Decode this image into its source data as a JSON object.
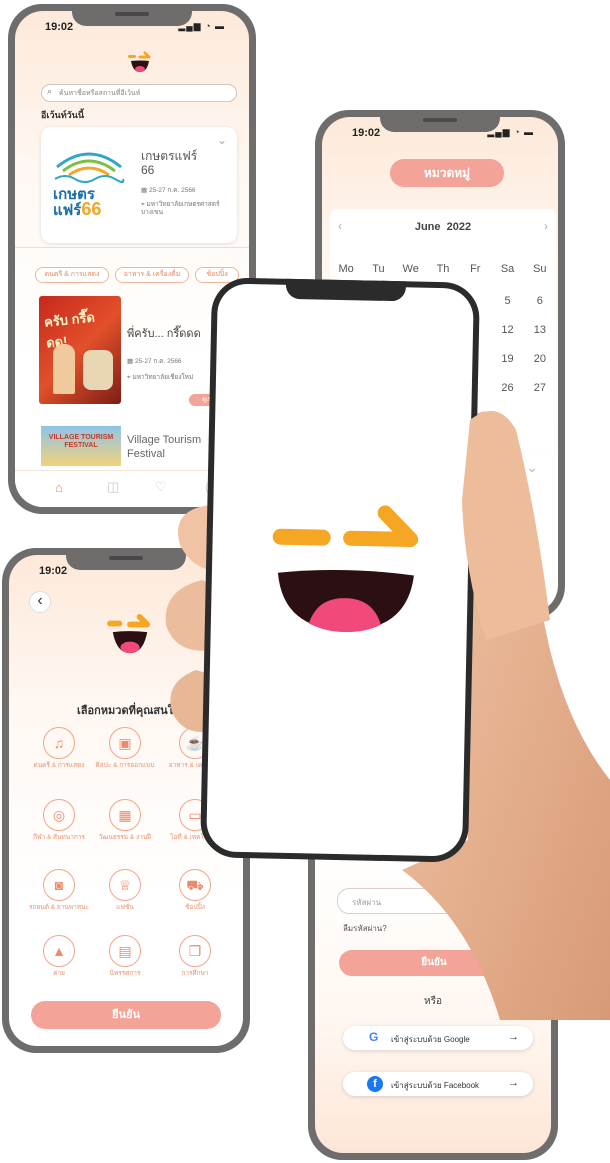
{
  "colors": {
    "accent": "#f3a397",
    "orange": "#f5a623",
    "mouth": "#2b0f12",
    "tongue": "#f0497a",
    "frame": "#6f6d6c"
  },
  "phone_home": {
    "time": "19:02",
    "search_placeholder": "ค้นหาชื่อหรือสถานที่อีเว้นท์",
    "section_title": "อีเว้นท์วันนี้",
    "featured": {
      "title": "เกษตรแฟร์",
      "title2": "66",
      "date": "25-27 ก.ค. 2566",
      "location": "มหาวิทยาลัยเกษตรศาสตร์ บางเขน",
      "logo_text": "เกษตร",
      "logo_text2": "แฟร์",
      "logo_num": "66"
    },
    "chips": [
      "ดนตรี & การแสดง",
      "อาหาร & เครื่องดื่ม",
      "ช้อปปิ้ง"
    ],
    "event2": {
      "title": "พี่ครับ... กรี๊ดดด",
      "date": "25-27 ก.ค. 2566",
      "location": "มหาวิทยาลัยเชียงใหม่",
      "poster_text": "ครับ กรี๊ดดด!",
      "badge": "ดูเพิ่ม"
    },
    "event3": {
      "title": "Village Tourism",
      "title2": "Festival",
      "poster_text": "VILLAGE TOURISM FESTIVAL"
    },
    "nav_icons": [
      "home-icon",
      "camera-icon",
      "heart-icon",
      "user-icon"
    ]
  },
  "phone_calendar": {
    "time": "19:02",
    "category_button": "หมวดหมู่",
    "month": "June",
    "year": "2022",
    "weekdays": [
      "Mo",
      "Tu",
      "We",
      "Th",
      "Fr",
      "Sa",
      "Su"
    ],
    "rows": [
      [
        "5",
        "6"
      ],
      [
        "12",
        "13"
      ],
      [
        "19",
        "20"
      ],
      [
        "26",
        "27"
      ]
    ]
  },
  "phone_categories": {
    "time": "19:02",
    "back": "‹",
    "heading": "เลือกหมวดที่คุณสนใจ",
    "categories": [
      {
        "icon": "♫",
        "label": "ดนตรี & การแสดง"
      },
      {
        "icon": "▣",
        "label": "ศิลปะ & การออกแบบ"
      },
      {
        "icon": "☕",
        "label": "อาหาร & เครื่องดื่ม"
      },
      {
        "icon": "◎",
        "label": "กีฬา & สันทนาการ"
      },
      {
        "icon": "▦",
        "label": "วัฒนธรรม & งานฝี"
      },
      {
        "icon": "▭",
        "label": "ไอที & เทคโนโลยี"
      },
      {
        "icon": "◙",
        "label": "รถยนต์ & ยานพาหนะ"
      },
      {
        "icon": "♕",
        "label": "แฟชั่น"
      },
      {
        "icon": "⛟",
        "label": "ช้อปปิ้ง"
      },
      {
        "icon": "▲",
        "label": "ค่าย"
      },
      {
        "icon": "▤",
        "label": "นิทรรศการ"
      },
      {
        "icon": "❒",
        "label": "การศึกษา"
      }
    ],
    "confirm": "ยืนยัน"
  },
  "phone_login": {
    "password_placeholder": "รหัสผ่าน",
    "forgot": "ลืมรหัสผ่าน?",
    "confirm": "ยืนยัน",
    "or": "หรือ",
    "google": "เข้าสู่ระบบด้วย Google",
    "facebook": "เข้าสู่ระบบด้วย Facebook"
  }
}
